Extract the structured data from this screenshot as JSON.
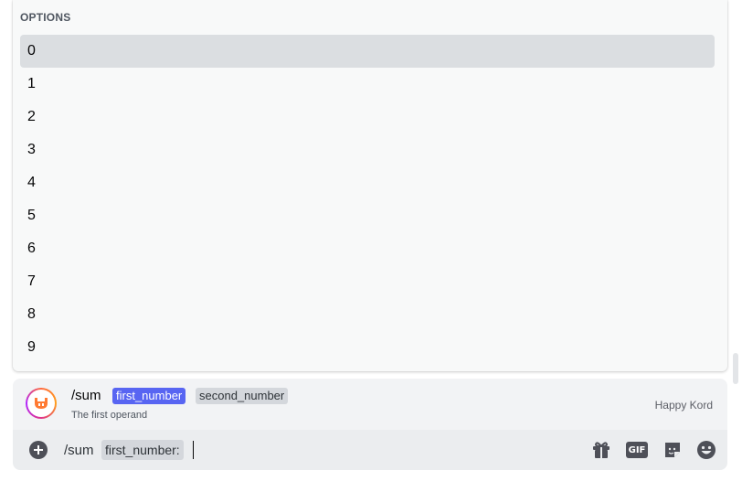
{
  "options_popup": {
    "header": "OPTIONS",
    "items": [
      {
        "label": "0",
        "selected": true
      },
      {
        "label": "1",
        "selected": false
      },
      {
        "label": "2",
        "selected": false
      },
      {
        "label": "3",
        "selected": false
      },
      {
        "label": "4",
        "selected": false
      },
      {
        "label": "5",
        "selected": false
      },
      {
        "label": "6",
        "selected": false
      },
      {
        "label": "7",
        "selected": false
      },
      {
        "label": "8",
        "selected": false
      },
      {
        "label": "9",
        "selected": false
      }
    ]
  },
  "command_preview": {
    "avatar_icon": "bot-avatar-icon",
    "command": "/sum",
    "params": [
      "first_number",
      "second_number"
    ],
    "active_param": "first_number",
    "description": "The first operand",
    "bot_name": "Happy Kord"
  },
  "input_bar": {
    "command": "/sum",
    "param_chip": "first_number:",
    "icons": [
      "add-circle-icon",
      "gift-icon",
      "gif-icon",
      "sticker-icon",
      "emoji-icon"
    ]
  },
  "colors": {
    "accent": "#5865f2",
    "selected_row": "#dbdee1",
    "popup_bg": "#f8f9f9"
  }
}
